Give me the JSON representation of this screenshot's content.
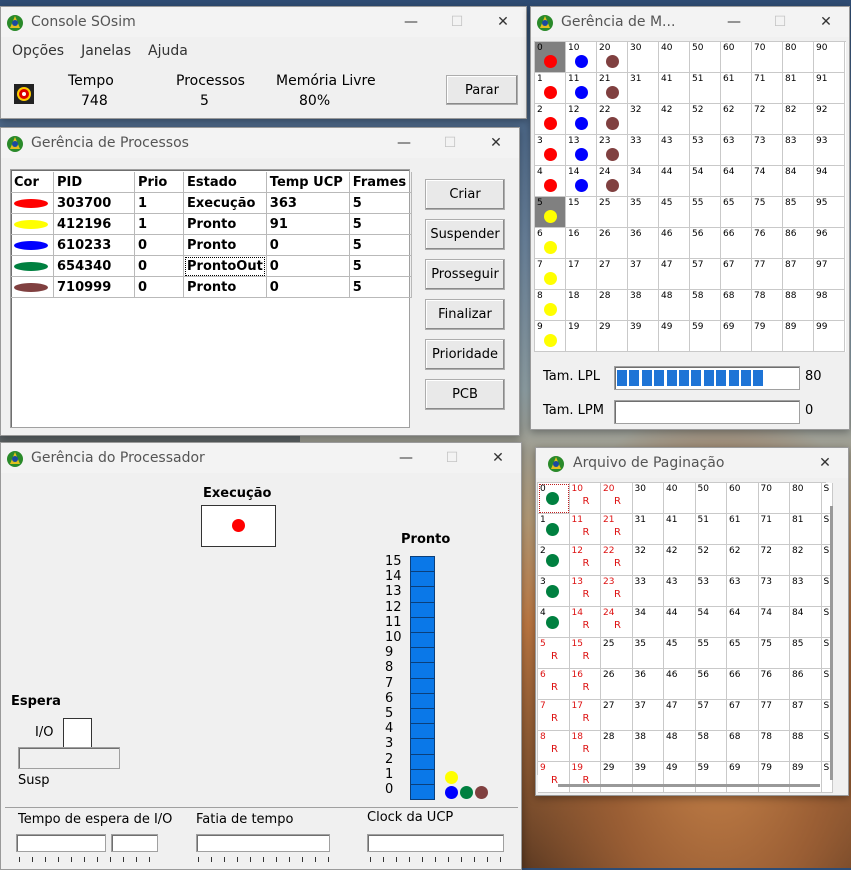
{
  "console": {
    "title": "Console SOsim",
    "menu": [
      "Opções",
      "Janelas",
      "Ajuda"
    ],
    "tempo_label": "Tempo",
    "tempo_value": "748",
    "processos_label": "Processos",
    "processos_value": "5",
    "memoria_label": "Memória Livre",
    "memoria_value": "80%",
    "parar_label": "Parar"
  },
  "processos": {
    "title": "Gerência de Processos",
    "headers": [
      "Cor",
      "PID",
      "Prio",
      "Estado",
      "Temp UCP",
      "Frames"
    ],
    "rows": [
      {
        "color": "#ff0000",
        "pid": "303700",
        "prio": "1",
        "estado": "Execução",
        "temp": "363",
        "frames": "5"
      },
      {
        "color": "#ffff00",
        "pid": "412196",
        "prio": "1",
        "estado": "Pronto",
        "temp": "91",
        "frames": "5"
      },
      {
        "color": "#0000ff",
        "pid": "610233",
        "prio": "0",
        "estado": "Pronto",
        "temp": "0",
        "frames": "5"
      },
      {
        "color": "#008040",
        "pid": "654340",
        "prio": "0",
        "estado": "ProntoOut",
        "temp": "0",
        "frames": "5"
      },
      {
        "color": "#804040",
        "pid": "710999",
        "prio": "0",
        "estado": "Pronto",
        "temp": "0",
        "frames": "5"
      }
    ],
    "buttons": [
      "Criar",
      "Suspender",
      "Prosseguir",
      "Finalizar",
      "Prioridade",
      "PCB"
    ]
  },
  "memoria": {
    "title": "Gerência de M...",
    "lpl_label": "Tam. LPL",
    "lpl_value": "80",
    "lpl_fill": 0.8,
    "lpm_label": "Tam. LPM",
    "lpm_value": "0",
    "frames": {
      "0": [
        "#ff0000",
        "#0000ff",
        "#804040"
      ],
      "1": [
        "#ff0000",
        "#0000ff",
        "#804040"
      ],
      "2": [
        "#ff0000",
        "#0000ff",
        "#804040"
      ],
      "3": [
        "#ff0000",
        "#0000ff",
        "#804040"
      ],
      "4": [
        "#ff0000",
        "#0000ff",
        "#804040"
      ],
      "5": [
        "#ffff00"
      ],
      "6": [
        "#ffff00"
      ],
      "7": [
        "#ffff00"
      ],
      "8": [
        "#ffff00"
      ],
      "9": [
        "#ffff00"
      ]
    }
  },
  "processador": {
    "title": "Gerência do Processador",
    "execucao_label": "Execução",
    "execucao_color": "#ff0000",
    "pronto_label": "Pronto",
    "pronto_levels": [
      "15",
      "14",
      "13",
      "12",
      "11",
      "10",
      "9",
      "8",
      "7",
      "6",
      "5",
      "4",
      "3",
      "2",
      "1",
      "0"
    ],
    "queue1": [
      "#ffff00"
    ],
    "queue0": [
      "#0000ff",
      "#008040",
      "#804040"
    ],
    "espera_label": "Espera",
    "io_label": "I/O",
    "susp_label": "Susp",
    "tempo_io_label": "Tempo de espera de I/O",
    "fatia_label": "Fatia de tempo",
    "clock_label": "Clock da UCP"
  },
  "paginacao": {
    "title": "Arquivo de Paginação",
    "r_label": "R",
    "first_col_colors": [
      "#008040",
      "#008040",
      "#008040",
      "#008040",
      "#008040"
    ],
    "red_cells": [
      5,
      6,
      7,
      8,
      9,
      10,
      11,
      12,
      13,
      14,
      15,
      16,
      17,
      18,
      19,
      20,
      21,
      22,
      23,
      24
    ]
  }
}
